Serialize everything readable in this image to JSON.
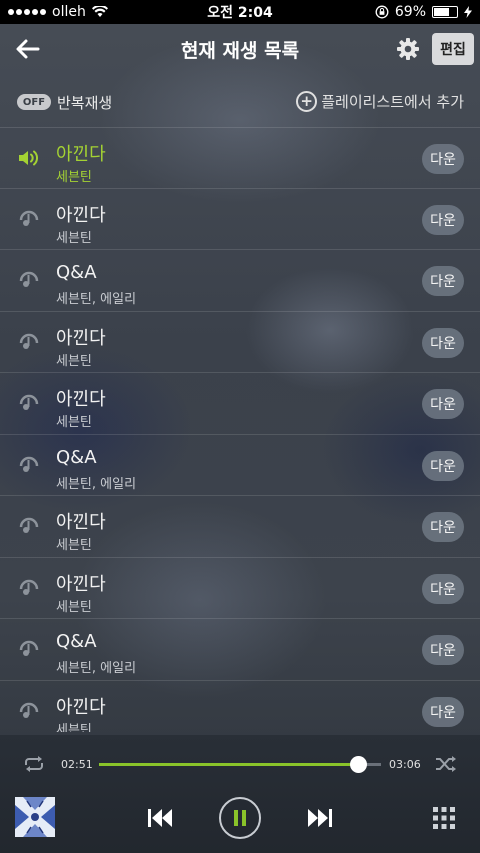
{
  "status_bar": {
    "carrier": "olleh",
    "time": "오전 2:04",
    "battery": "69%",
    "battery_level": 0.69
  },
  "header": {
    "title": "현재 재생 목록",
    "edit_label": "편집"
  },
  "options": {
    "repeat_toggle": "OFF",
    "repeat_label": "반복재생",
    "add_playlist_label": "플레이리스트에서 추가"
  },
  "tracks": [
    {
      "title": "아낀다",
      "artist": "세븐틴",
      "down_label": "다운",
      "active": true
    },
    {
      "title": "아낀다",
      "artist": "세븐틴",
      "down_label": "다운",
      "active": false
    },
    {
      "title": "Q&A",
      "artist": "세븐틴, 에일리",
      "down_label": "다운",
      "active": false
    },
    {
      "title": "아낀다",
      "artist": "세븐틴",
      "down_label": "다운",
      "active": false
    },
    {
      "title": "아낀다",
      "artist": "세븐틴",
      "down_label": "다운",
      "active": false
    },
    {
      "title": "Q&A",
      "artist": "세븐틴, 에일리",
      "down_label": "다운",
      "active": false
    },
    {
      "title": "아낀다",
      "artist": "세븐틴",
      "down_label": "다운",
      "active": false
    },
    {
      "title": "아낀다",
      "artist": "세븐틴",
      "down_label": "다운",
      "active": false
    },
    {
      "title": "Q&A",
      "artist": "세븐틴, 에일리",
      "down_label": "다운",
      "active": false
    },
    {
      "title": "아낀다",
      "artist": "세븐틴",
      "down_label": "다운",
      "active": false
    }
  ],
  "player": {
    "current_time": "02:51",
    "total_time": "03:06",
    "progress": 0.92
  },
  "colors": {
    "accent": "#8ac42a",
    "active_text": "#a4d233"
  },
  "icons": {
    "back": "arrow-left-icon",
    "settings": "gear-icon",
    "add": "plus-circle-icon",
    "active_track": "speaker-icon",
    "track": "music-note-icon",
    "repeat": "repeat-icon",
    "shuffle": "shuffle-icon",
    "prev": "skip-previous-icon",
    "pause": "pause-icon",
    "next": "skip-next-icon",
    "menu": "grid-icon"
  }
}
